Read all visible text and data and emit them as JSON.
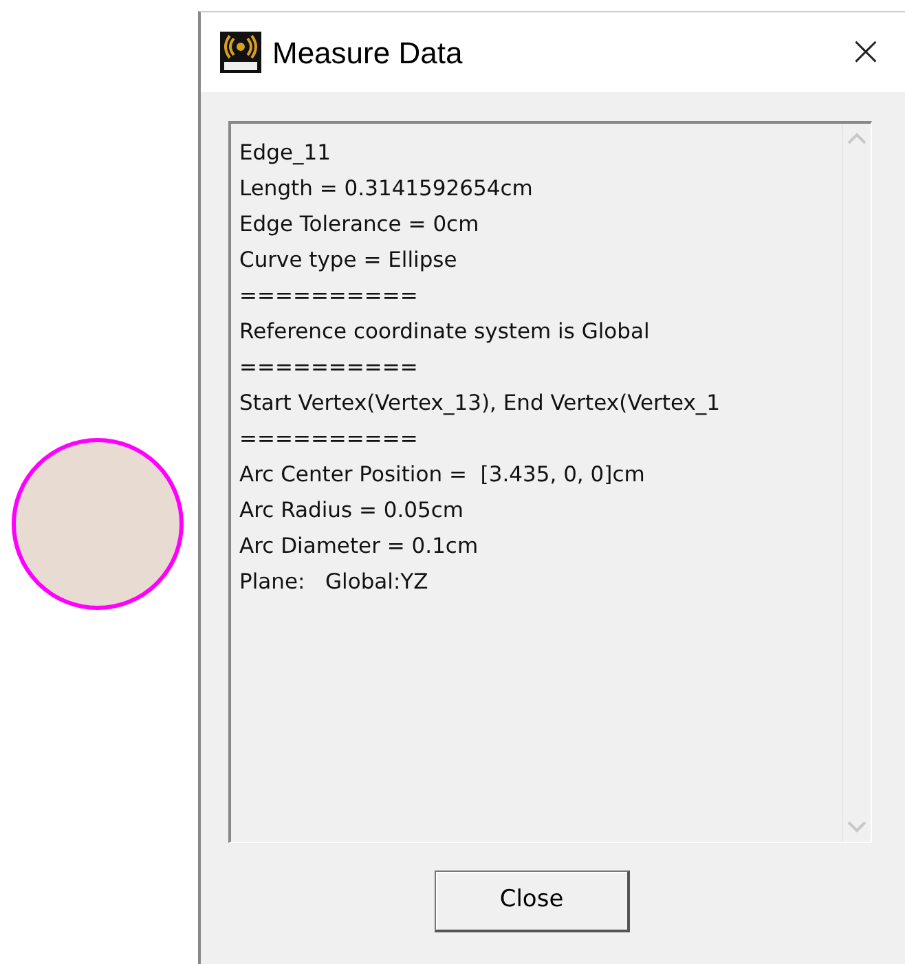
{
  "window": {
    "title": "Measure Data",
    "close_glyph": "×"
  },
  "output_lines": [
    "Edge_11",
    "Length = 0.3141592654cm",
    "Edge Tolerance = 0cm",
    "Curve type = Ellipse",
    "==========",
    "Reference coordinate system is Global",
    "==========",
    "Start Vertex(Vertex_13), End Vertex(Vertex_1",
    "==========",
    "Arc Center Position =  [3.435, 0, 0]cm",
    "Arc Radius = 0.05cm",
    "Arc Diameter = 0.1cm",
    "Plane:   Global:YZ"
  ],
  "buttons": [
    "Close"
  ]
}
